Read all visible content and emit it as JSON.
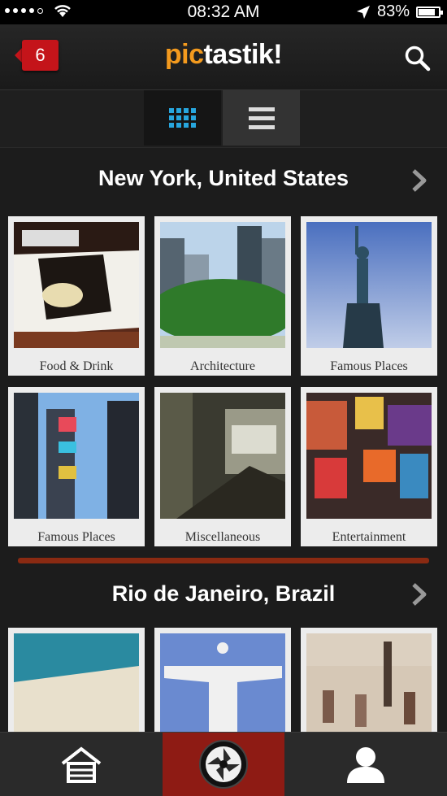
{
  "status_bar": {
    "time": "08:32 AM",
    "battery": "83%",
    "battery_level": 0.83
  },
  "header": {
    "badge_count": "6",
    "logo_pic": "pic",
    "logo_rest": "tastik!"
  },
  "sections": [
    {
      "title": "New York, United States",
      "tiles": [
        "Food & Drink",
        "Architecture",
        "Famous Places",
        "Famous Places",
        "Miscellaneous",
        "Entertainment"
      ]
    },
    {
      "title": "Rio de Janeiro, Brazil"
    }
  ],
  "colors": {
    "accent": "#f39a1e",
    "badge": "#c4141a",
    "grid_icon": "#27a6de",
    "tab_center": "#8e1b14"
  },
  "icons": [
    "search-icon",
    "grid-view-icon",
    "list-view-icon",
    "chevron-right-icon",
    "home-icon",
    "camera-lens-icon",
    "profile-icon"
  ]
}
